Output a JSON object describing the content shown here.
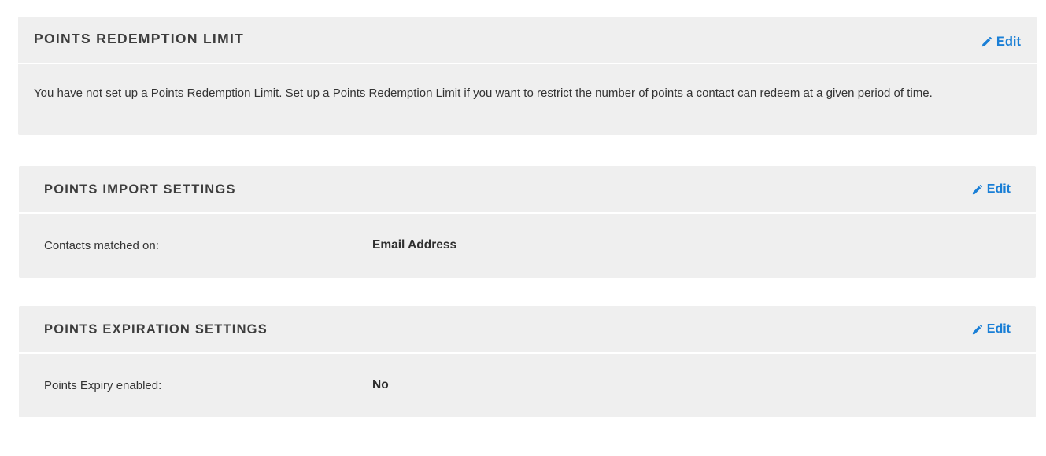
{
  "accent_color": "#1a7fd6",
  "redemption_limit": {
    "title": "POINTS REDEMPTION LIMIT",
    "edit_label": "Edit",
    "edit_icon": "pencil-icon",
    "message": "You have not set up a Points Redemption Limit. Set up a Points Redemption Limit if you want to restrict the number of points a contact can redeem at a given period of time."
  },
  "import_settings": {
    "title": "POINTS IMPORT SETTINGS",
    "edit_label": "Edit",
    "edit_icon": "pencil-icon",
    "rows": [
      {
        "label": "Contacts matched on:",
        "value": "Email Address"
      }
    ]
  },
  "expiration_settings": {
    "title": "POINTS EXPIRATION SETTINGS",
    "edit_label": "Edit",
    "edit_icon": "pencil-icon",
    "rows": [
      {
        "label": "Points Expiry enabled:",
        "value": "No"
      }
    ]
  }
}
